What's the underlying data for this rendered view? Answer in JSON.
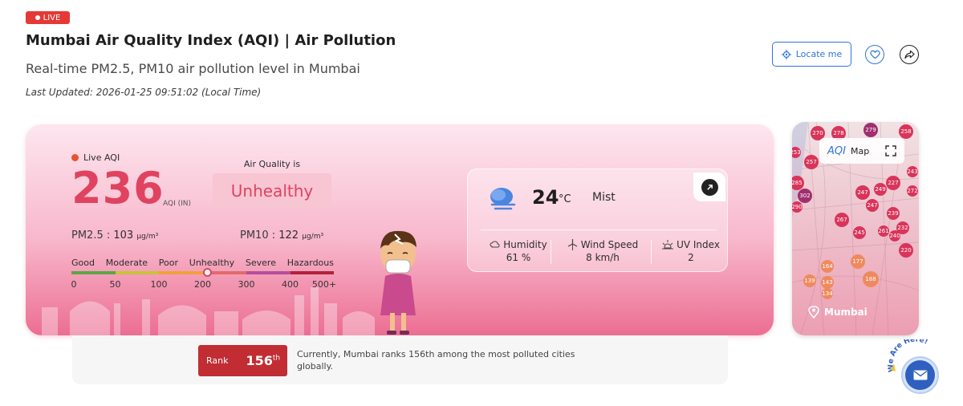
{
  "header": {
    "live_badge": "LIVE",
    "title": "Mumbai Air Quality Index (AQI) | Air Pollution",
    "subtitle": "Real-time PM2.5, PM10 air pollution level in Mumbai",
    "last_updated": "Last Updated: 2026-01-25 09:51:02 (Local Time)",
    "locate_label": "Locate me",
    "icons": [
      "locate-icon",
      "heart-icon",
      "share-icon"
    ]
  },
  "aqi": {
    "live_label": "Live AQI",
    "value": "236",
    "unit": "AQI (IN)",
    "quality_heading": "Air Quality is",
    "status": "Unhealthy",
    "pm25_label": "PM2.5 :",
    "pm25_value": "103",
    "pm25_unit": "μg/m³",
    "pm10_label": "PM10 :",
    "pm10_value": "122",
    "pm10_unit": "μg/m³",
    "scale_categories": [
      "Good",
      "Moderate",
      "Poor",
      "Unhealthy",
      "Severe",
      "Hazardous"
    ],
    "scale_colors": [
      "#5ea545",
      "#c9c23a",
      "#f0a13a",
      "#e36a6a",
      "#b34f9c",
      "#b22238"
    ],
    "scale_numbers": [
      "0",
      "50",
      "100",
      "200",
      "300",
      "400",
      "500+"
    ],
    "marker_position_fraction": 0.5166,
    "status_color": "#e0435f"
  },
  "weather": {
    "temperature": "24",
    "temp_unit": "°C",
    "condition": "Mist",
    "humidity_label": "Humidity",
    "humidity_value": "61 %",
    "wind_label": "Wind Speed",
    "wind_value": "8 km/h",
    "uv_label": "UV Index",
    "uv_value": "2",
    "icons": [
      "mist-cloud-icon",
      "expand-arrow-icon",
      "humidity-icon",
      "wind-turbine-icon",
      "uv-sun-icon"
    ]
  },
  "rank": {
    "label": "Rank",
    "value": "156",
    "suffix": "th",
    "text": "Currently, Mumbai ranks 156th among the most polluted cities globally."
  },
  "map": {
    "brand": "AQI",
    "label": "Map",
    "city": "Mumbai",
    "pins": [
      "270",
      "278",
      "279",
      "258",
      "253",
      "257",
      "243",
      "285",
      "227",
      "272",
      "302",
      "247",
      "249",
      "290",
      "247",
      "239",
      "267",
      "261",
      "232",
      "245",
      "240",
      "220",
      "177",
      "164",
      "139",
      "143",
      "188",
      "134"
    ]
  },
  "widget": {
    "tagline": "We Are Here!"
  }
}
